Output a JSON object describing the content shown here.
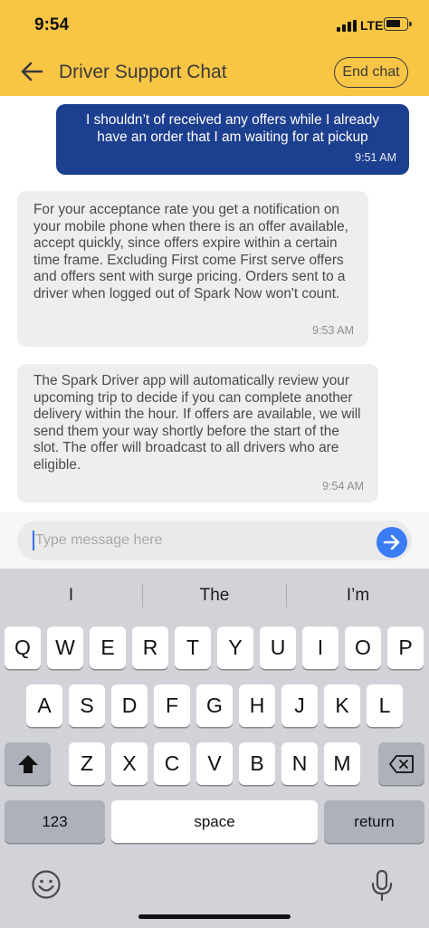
{
  "status_bar": {
    "time": "9:54",
    "network": "LTE"
  },
  "header": {
    "title": "Driver Support Chat",
    "end_chat_label": "End chat"
  },
  "messages": [
    {
      "direction": "outgoing",
      "text": "I shouldn’t of received any offers while I already have an order that I am waiting for at pickup",
      "time": "9:51 AM"
    },
    {
      "direction": "incoming",
      "text": "For your acceptance rate you get a notification on your mobile phone when there is an offer available, accept quickly, since offers expire within a certain time frame. Excluding First come First serve offers and offers sent with surge pricing. Orders sent to a driver when logged out of Spark Now won't count.",
      "time": "9:53 AM"
    },
    {
      "direction": "incoming",
      "text": "The Spark Driver app will automatically review your upcoming trip to decide if you can complete another delivery within the hour. If offers are available, we will send them your way shortly before the start of the slot.  The offer will broadcast to all drivers who are eligible.",
      "time": "9:54 AM"
    }
  ],
  "composer": {
    "placeholder": "Type message here"
  },
  "keyboard": {
    "suggestions": [
      "I",
      "The",
      "I’m"
    ],
    "row1": [
      "Q",
      "W",
      "E",
      "R",
      "T",
      "Y",
      "U",
      "I",
      "O",
      "P"
    ],
    "row2": [
      "A",
      "S",
      "D",
      "F",
      "G",
      "H",
      "J",
      "K",
      "L"
    ],
    "row3": [
      "Z",
      "X",
      "C",
      "V",
      "B",
      "N",
      "M"
    ],
    "numbers_label": "123",
    "space_label": "space",
    "return_label": "return"
  },
  "colors": {
    "header_bg": "#f8c545",
    "outgoing_bubble": "#1d3f8f",
    "incoming_bubble": "#eeeeee",
    "send_button": "#3b7cf4"
  },
  "icons": [
    "back-arrow-icon",
    "signal-icon",
    "battery-icon",
    "send-arrow-icon",
    "shift-icon",
    "backspace-icon",
    "emoji-icon",
    "microphone-icon"
  ]
}
